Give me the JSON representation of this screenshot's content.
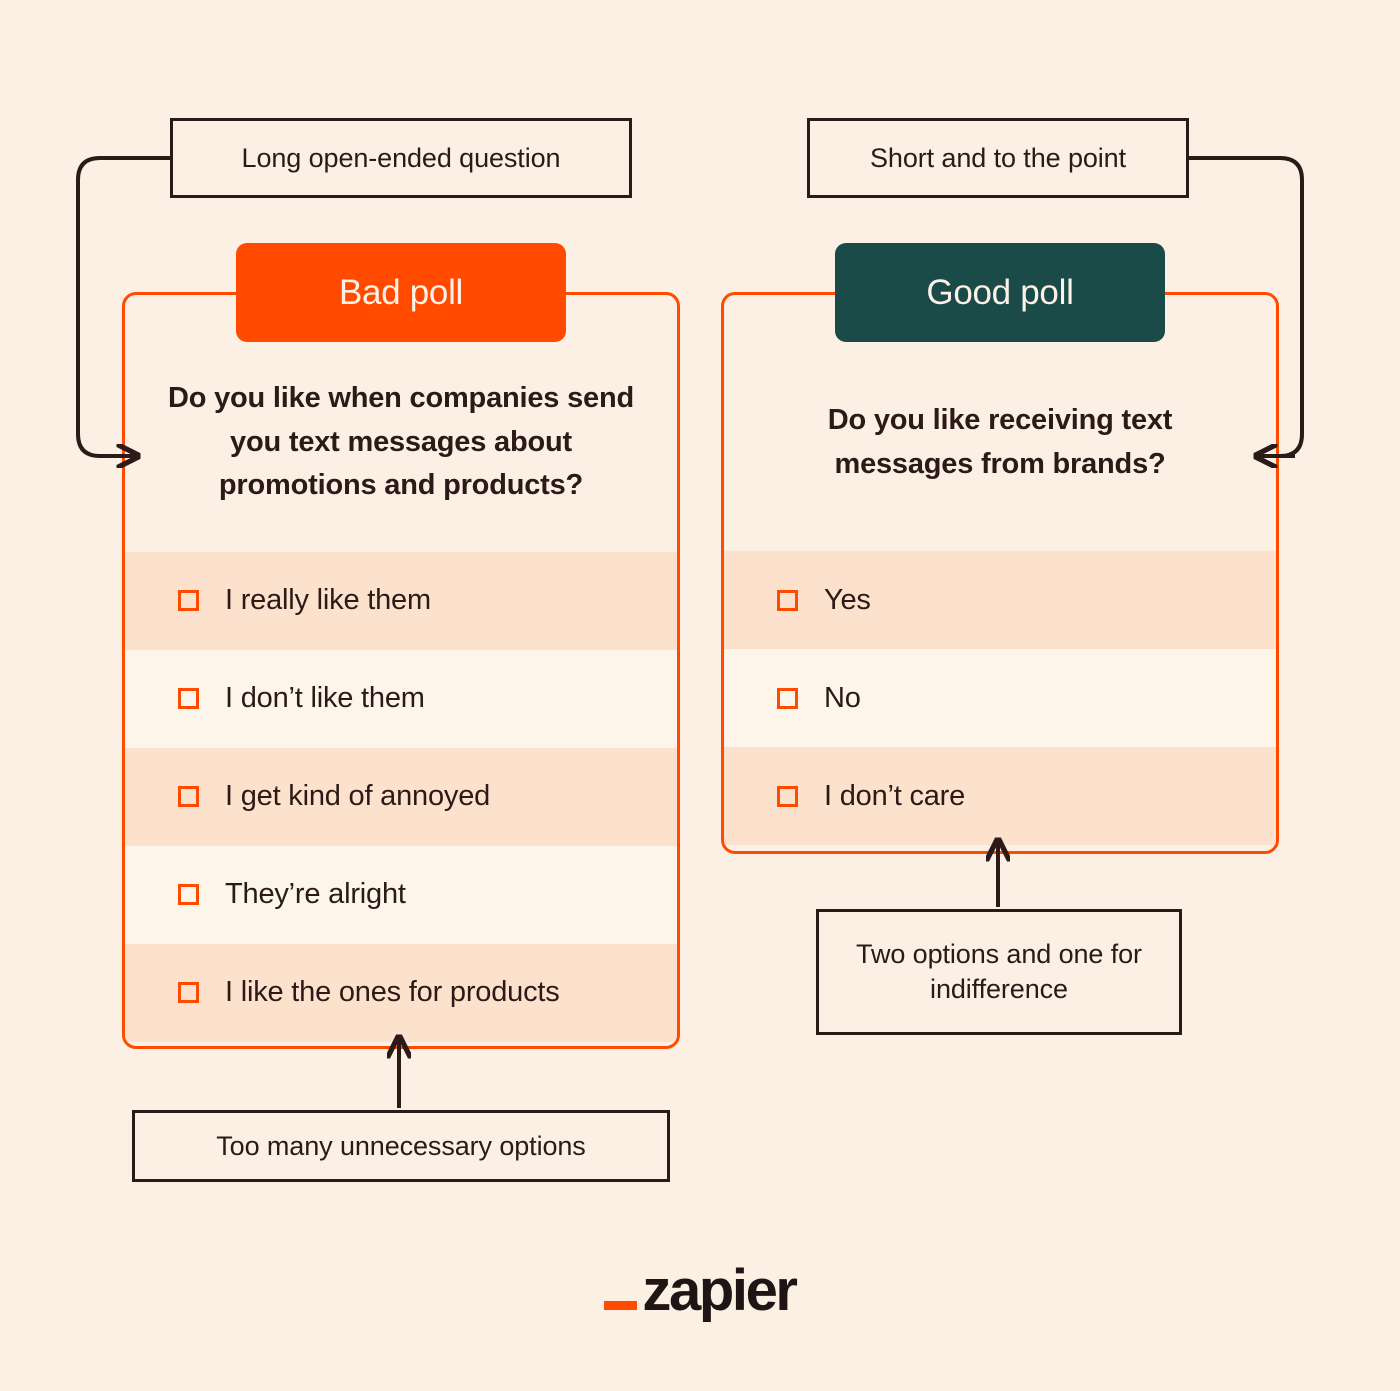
{
  "canvas": {
    "background": "#FCF0E5",
    "accent_orange": "#FF4A00",
    "accent_teal": "#1A4B49",
    "ink": "#2B1A17",
    "stripe_dark": "#FCE1CC",
    "stripe_light": "#FDF4EA"
  },
  "callouts": {
    "long_question": "Long open-ended question",
    "short_point": "Short and to the point",
    "too_many_options": "Too many unnecessary options",
    "two_options": "Two options and one for indifference"
  },
  "polls": {
    "bad": {
      "badge": "Bad poll",
      "question": "Do you like when companies send you text messages about promotions and products?",
      "options": [
        "I really like them",
        "I don’t like them",
        "I get kind of annoyed",
        "They’re alright",
        "I like the ones for products"
      ]
    },
    "good": {
      "badge": "Good poll",
      "question": "Do you like receiving text messages from brands?",
      "options": [
        "Yes",
        "No",
        "I don’t care"
      ]
    }
  },
  "branding": {
    "wordmark": "zapier"
  }
}
